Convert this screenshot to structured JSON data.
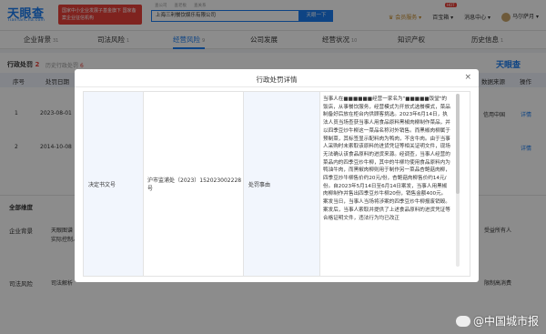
{
  "header": {
    "logo_text": "天眼查",
    "logo_sub": "TianYanCha.com",
    "promo_text": "国家中小企业发展子基金旗下 国家备案企业征信机构",
    "search_tabs": [
      "查公司",
      "查老板",
      "查关系"
    ],
    "search_value": "上海三利餐饮娱乐有限公司",
    "search_button": "天眼一下",
    "vip_label": "会员服务",
    "baike_label": "百宝箱",
    "hot_badge": "HOT",
    "messages_label": "消息中心",
    "user_name": "马尔萨月"
  },
  "nav": {
    "items": [
      {
        "label": "企业背景",
        "count": "31"
      },
      {
        "label": "司法风险",
        "count": "1"
      },
      {
        "label": "经营风险",
        "count": "9"
      },
      {
        "label": "公司发展",
        "count": ""
      },
      {
        "label": "经营状况",
        "count": "10"
      },
      {
        "label": "知识产权",
        "count": ""
      },
      {
        "label": "历史信息",
        "count": "1"
      }
    ]
  },
  "background": {
    "section_title": "行政处罚",
    "section_count": "2",
    "section_sub": "历史行政处罚",
    "section_sub_count": "6",
    "logo2": "天眼查",
    "col_seq": "序号",
    "col_date": "处罚日期",
    "col_source": "数据来源",
    "col_action": "操作",
    "rows": [
      {
        "seq": "1",
        "date": "2023-08-01",
        "source": "信用中国",
        "action": "详情"
      },
      {
        "seq": "2",
        "date": "2014-10-08",
        "source": "",
        "action": "详情"
      }
    ],
    "dimension_label": "全部维度",
    "dimensions": [
      {
        "label": "企业背景",
        "value": "天眼图谱"
      },
      {
        "label": "司法风险",
        "value": "司法解析"
      }
    ],
    "shareholder_label": "限制高消费",
    "extra_text": "实际控制人",
    "dishonest_label": "受益所有人"
  },
  "modal": {
    "title": "行政处罚详情",
    "close_icon": "×",
    "doc_label": "决定书文号",
    "doc_value": "沪市监浦处（2023）152023002228号",
    "reason_label": "处罚事由",
    "reason_text": "当事人在■■■■■■经营一家名为\"■■■■■饭堂\"的饭店，从事餐饮服务，经营模式为开放式选餐模式，菜品制备好后放在柜台内供顾客挑选。2023年6月14日，执法人员当场查获当事人用食品原料黑椒肉柳制作菜品，并以四季豆炒牛柳这一菜品名称对外销售。而黑椒肉柳属于预制菜，其标签显示配料肉为鸭肉，不含牛肉。由于当事人采购时未索取该原料的进货凭证等相关证明文件，现场无法确认该食品原料的进货来源。经调查，当事人经营的菜品内的四季豆炒牛柳，其中的牛柳均使用食品原料内为鸭油牛肉，而黑椒肉柳则用于制作另一菜品杏鲍菇肉柳，四季豆炒牛柳售价约20元/份，杏鲍菇肉柳售价约14元/份。自2023年5月14日至6月14日案发，当事人用黑椒肉柳制作并售出四季豆炒牛柳20份，销售金额400元。案发当日，当事人当场将涉案的四季豆炒牛柳报废销毁。案发后，当事人索取并提供了上述食品原料的进货凭证等合格证明文件，违法行为均已改正"
  },
  "watermark": {
    "text": "@中国城市报"
  },
  "colors": {
    "brand": "#1a7cf0",
    "alert": "#e8413a",
    "label_bg": "#f2f6fd"
  }
}
